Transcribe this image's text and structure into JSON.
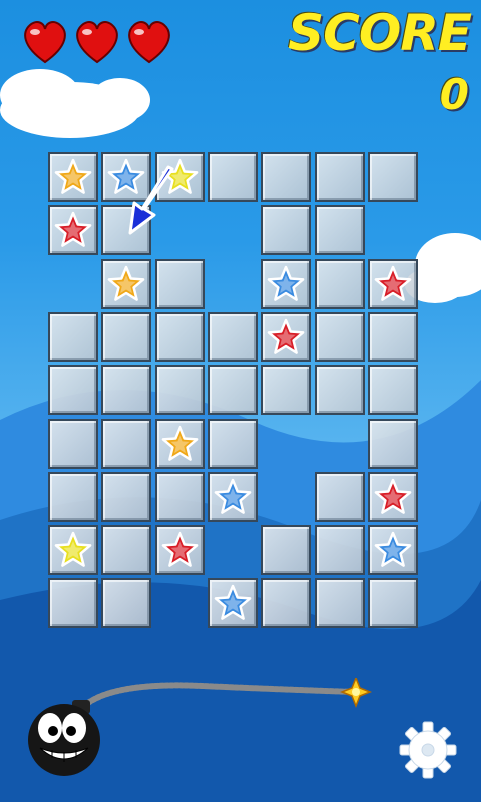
{
  "hud": {
    "score_label": "SCORE",
    "score_value": "0",
    "lives": 3
  },
  "colors": {
    "gold": "#f0a818",
    "blue": "#3a8be0",
    "red": "#d81e28",
    "yellow": "#e8e020",
    "heart": "#e01010",
    "arrow": "#1a2fd8",
    "score_text": "#ffee22"
  },
  "board": {
    "columns": 7,
    "rows": 9,
    "grid": [
      [
        "gold",
        "blue",
        "yellow",
        "",
        "",
        "",
        ""
      ],
      [
        "red",
        "",
        null,
        null,
        "",
        "",
        null
      ],
      [
        null,
        "gold",
        "",
        null,
        "blue",
        "",
        "red"
      ],
      [
        "",
        "",
        "",
        "",
        "red",
        "",
        ""
      ],
      [
        "",
        "",
        "",
        "",
        "",
        "",
        ""
      ],
      [
        "",
        "",
        "gold",
        "",
        null,
        null,
        ""
      ],
      [
        "",
        "",
        "",
        "blue",
        null,
        "",
        "red"
      ],
      [
        "yellow",
        "",
        "red",
        null,
        "",
        "",
        "blue"
      ],
      [
        "",
        "",
        null,
        "blue",
        "",
        "",
        ""
      ]
    ]
  },
  "icons": {
    "pointer": "arrow-pointer-icon",
    "bomb": "bomb-icon",
    "settings": "gear-icon",
    "heart": "heart-icon"
  }
}
